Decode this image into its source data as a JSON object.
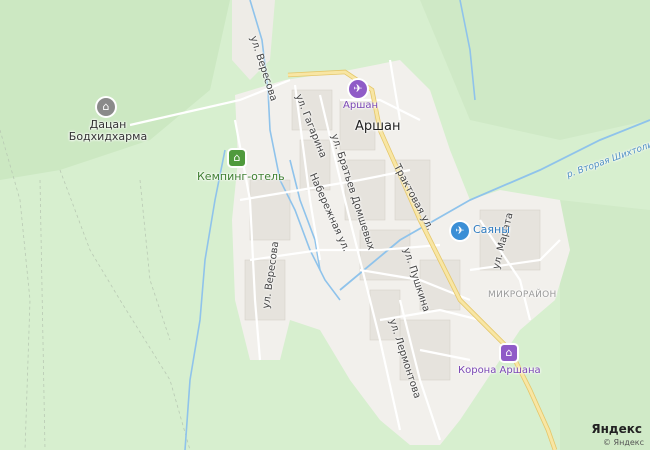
{
  "map": {
    "town": "Аршан",
    "district": "МИКРОРАЙОН",
    "river": "р. Вторая Шихтолина"
  },
  "streets": [
    {
      "id": "veresova-north",
      "name": "ул. Вересова"
    },
    {
      "id": "gagarina",
      "name": "ул. Гагарина"
    },
    {
      "id": "bratyev-domshevykh",
      "name": "ул. Братьев Домшевых"
    },
    {
      "id": "traktovaya",
      "name": "Трактовая ул."
    },
    {
      "id": "naberezhnaya",
      "name": "Набережная ул."
    },
    {
      "id": "veresova-south",
      "name": "ул. Вересова"
    },
    {
      "id": "marata",
      "name": "ул. Марата"
    },
    {
      "id": "pushkina",
      "name": "ул. Пушкина"
    },
    {
      "id": "lermontova",
      "name": "ул. Лермонтова"
    }
  ],
  "pois": [
    {
      "id": "datsan",
      "name": "Дацан Бодхидхарма",
      "icon": "temple-icon",
      "color": "#8a8a8a"
    },
    {
      "id": "camping",
      "name": "Кемпинг-отель",
      "icon": "hotel-icon",
      "color": "#4f9a3c"
    },
    {
      "id": "arshan-sanatorium",
      "name": "Аршан",
      "icon": "sanatorium-icon",
      "color": "#8f5bc7"
    },
    {
      "id": "sayany",
      "name": "Саяны",
      "icon": "sanatorium-icon",
      "color": "#3b8fd6"
    },
    {
      "id": "korona",
      "name": "Корона Аршана",
      "icon": "hotel-icon",
      "color": "#8f5bc7"
    }
  ],
  "attribution": {
    "logo": "Яндекс",
    "copyright": "© Яндекс"
  },
  "colors": {
    "forest": "#d7efcf",
    "settlement": "#f2f0ec",
    "road_main": "#f5e29a",
    "water": "#8fc3eb"
  }
}
